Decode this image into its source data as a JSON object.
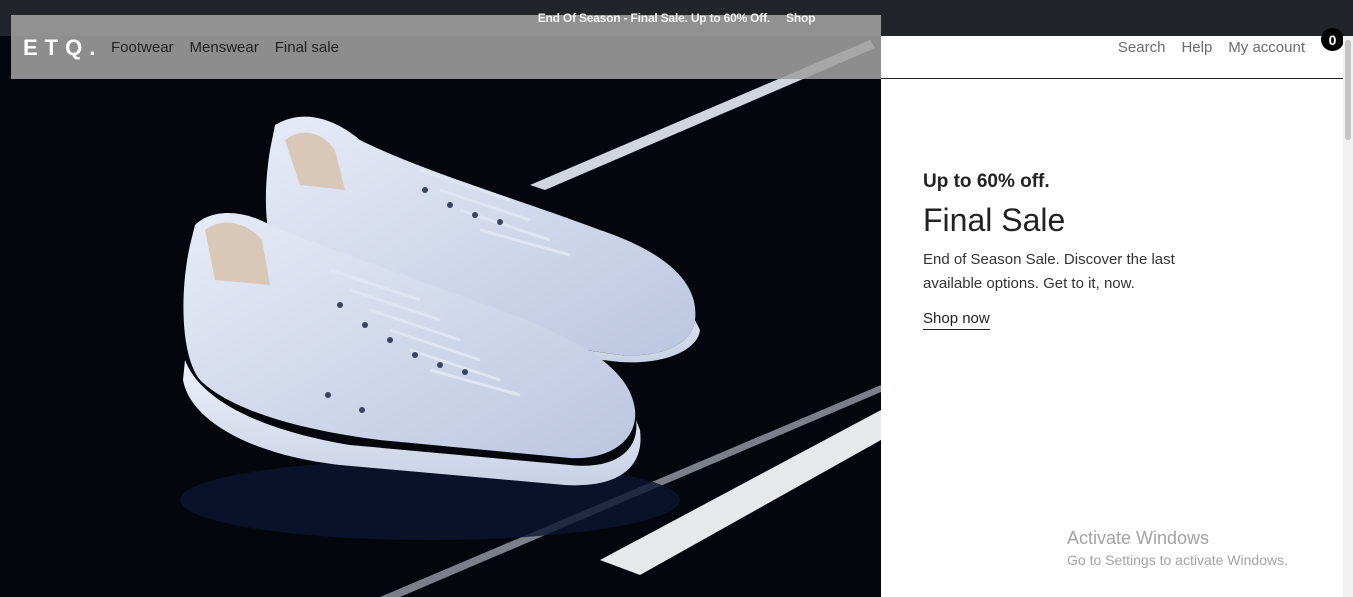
{
  "announcement": {
    "text": "End Of Season - Final Sale. Up to 60% Off.",
    "link": "Shop"
  },
  "header": {
    "logo": "ETQ.",
    "nav_left": [
      "Footwear",
      "Menswear",
      "Final sale"
    ],
    "nav_right": [
      "Search",
      "Help",
      "My account"
    ],
    "cart_count": "0"
  },
  "hero": {
    "image_icon": "sneakers-photo",
    "subtitle": "Up to 60% off.",
    "title": "Final Sale",
    "description": "End of Season Sale. Discover the last available options. Get to it, now.",
    "cta": "Shop now"
  },
  "watermark": {
    "line1": "Activate Windows",
    "line2": "Go to Settings to activate Windows."
  },
  "colors": {
    "header_overlay": "#a0a0a0",
    "hero_bg": "#03060c",
    "badge": "#000000",
    "text": "#222222"
  }
}
